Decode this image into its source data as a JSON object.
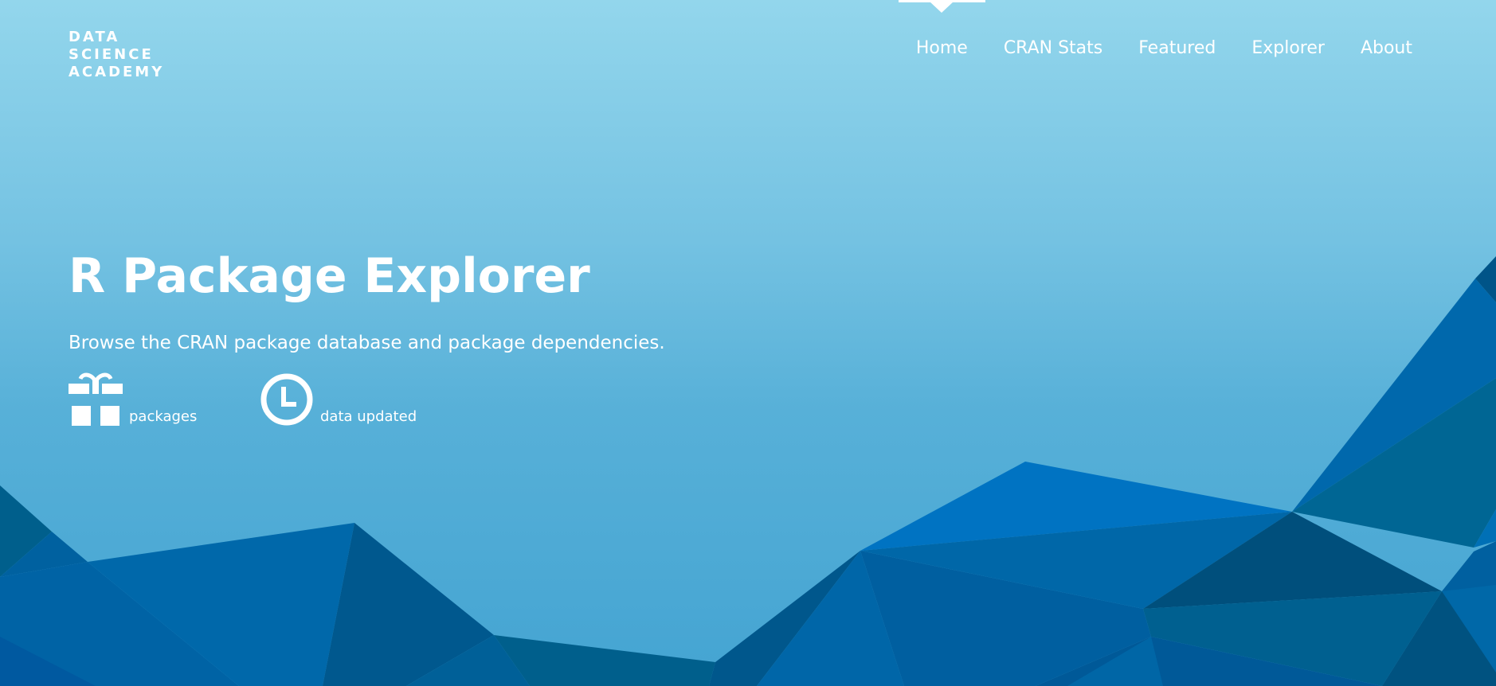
{
  "brand": {
    "line1": "DATA",
    "line2": "SCIENCE",
    "line3": "ACADEMY"
  },
  "nav": {
    "items": [
      {
        "label": "Home",
        "active": true
      },
      {
        "label": "CRAN Stats"
      },
      {
        "label": "Featured"
      },
      {
        "label": "Explorer"
      },
      {
        "label": "About"
      }
    ]
  },
  "hero": {
    "title": "R Package Explorer",
    "subtitle": "Browse the CRAN package database and package dependencies."
  },
  "stats": {
    "packages": {
      "label": "packages",
      "icon": "gift-icon"
    },
    "updated": {
      "label": "data updated",
      "icon": "clock-icon"
    }
  },
  "colors": {
    "sky_top": "#93d6ec",
    "sky_bottom": "#44a4d2",
    "text": "#ffffff",
    "poly_dark": "#00507e",
    "poly_mid": "#0065a8",
    "poly_bright": "#0072c2",
    "poly_teal": "#006590"
  }
}
